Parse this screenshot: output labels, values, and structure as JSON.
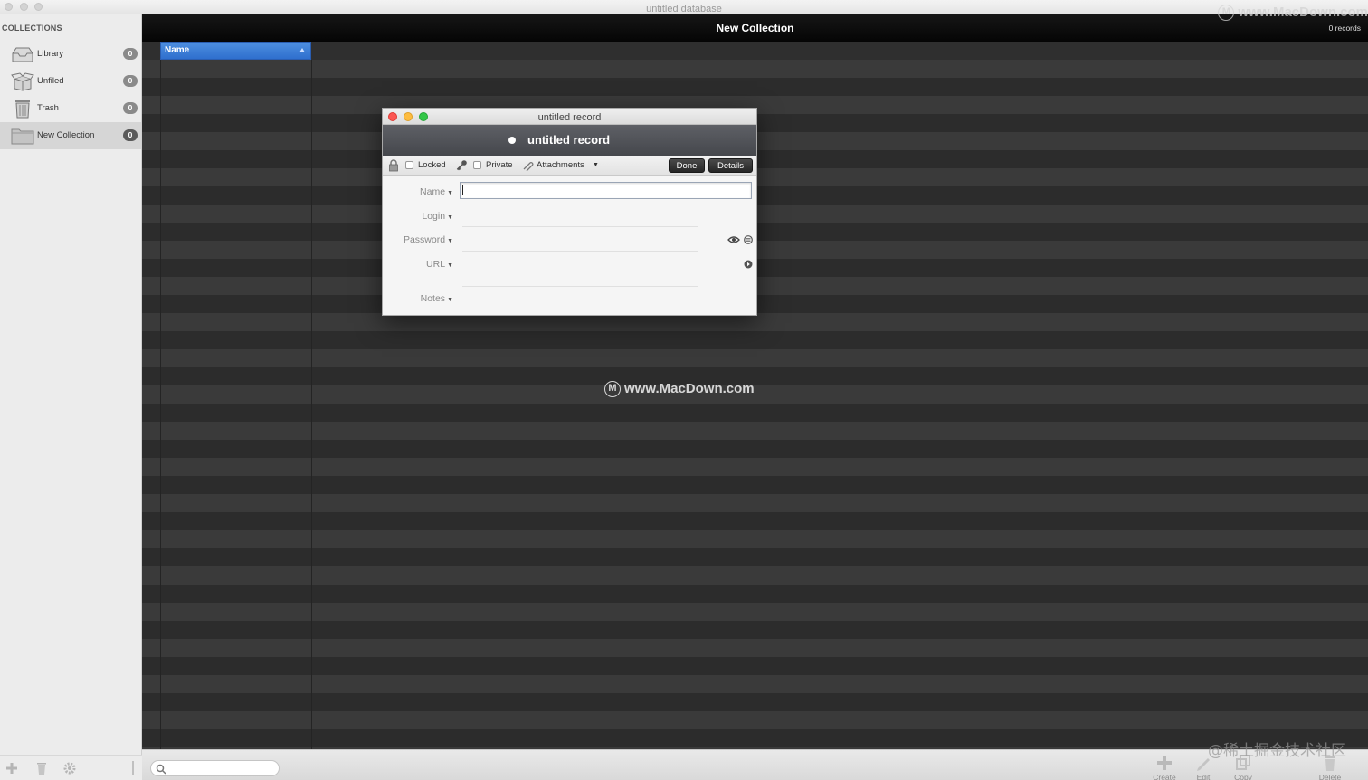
{
  "window": {
    "title": "untitled database"
  },
  "sidebar": {
    "heading": "COLLECTIONS",
    "items": [
      {
        "label": "Library",
        "count": "0",
        "icon": "inbox-tray-icon"
      },
      {
        "label": "Unfiled",
        "count": "0",
        "icon": "open-box-icon"
      },
      {
        "label": "Trash",
        "count": "0",
        "icon": "trash-can-icon"
      },
      {
        "label": "New Collection",
        "count": "0",
        "icon": "folder-icon",
        "selected": true
      }
    ]
  },
  "main": {
    "title": "New Collection",
    "record_count": "0 records",
    "column_header": "Name",
    "sort": "ascending"
  },
  "dialog": {
    "window_title": "untitled record",
    "record_name": "untitled record",
    "toolbar": {
      "locked_label": "Locked",
      "locked_checked": false,
      "private_label": "Private",
      "private_checked": false,
      "attachments_label": "Attachments",
      "done_label": "Done",
      "details_label": "Details"
    },
    "fields": {
      "name_label": "Name",
      "name_value": "",
      "login_label": "Login",
      "password_label": "Password",
      "url_label": "URL",
      "notes_label": "Notes"
    }
  },
  "bottombar": {
    "search_placeholder": "",
    "create_label": "Create",
    "edit_label": "Edit",
    "copy_label": "Copy",
    "delete_label": "Delete"
  },
  "watermarks": {
    "top_right": "www.MacDown.com",
    "center": "www.MacDown.com",
    "bottom_right": "@稀土掘金技术社区"
  },
  "colors": {
    "selection_blue": "#3a7bd5",
    "list_dark": "#2f2f2f",
    "sidebar_bg": "#ececec"
  }
}
